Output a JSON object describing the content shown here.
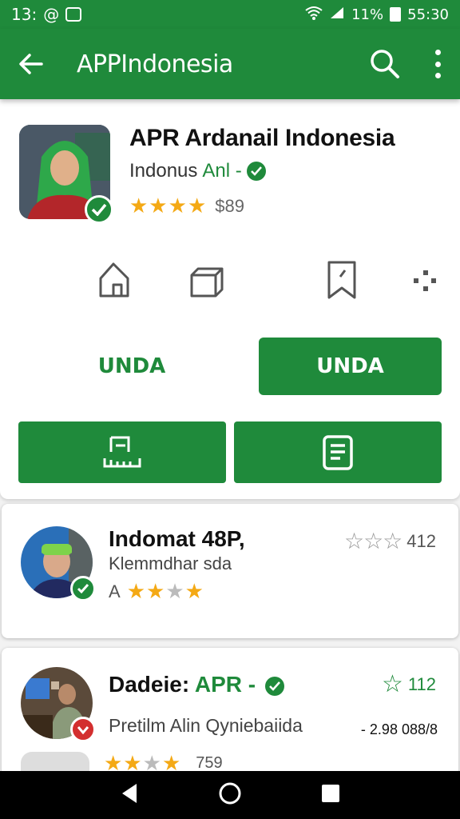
{
  "status_bar": {
    "time": "13:",
    "time_icon": "@",
    "right_text": "11%",
    "clock": "55:30"
  },
  "app_bar": {
    "title": "APPIndonesia"
  },
  "app": {
    "title": "APR Ardanail Indonesia",
    "developer_prefix": "Indonus",
    "developer_accent": "Anl -",
    "rating_value": "$89"
  },
  "buttons": {
    "secondary_label": "UNDA",
    "primary_label": "UNDA"
  },
  "cards": [
    {
      "title": "Indomat 48P,",
      "subtitle": "Klemmdhar sda",
      "rating_prefix": "A",
      "right_count": "412"
    },
    {
      "title": "Dadeie: ",
      "title_accent": "APR -",
      "subtitle": "Pretilm Alin Qyniebaiida",
      "right_count": "112",
      "right_value": "- 2.98 088/8"
    }
  ],
  "peek": {
    "value": "759"
  },
  "colors": {
    "primary": "#1f8a3b",
    "star": "#f4a915"
  }
}
